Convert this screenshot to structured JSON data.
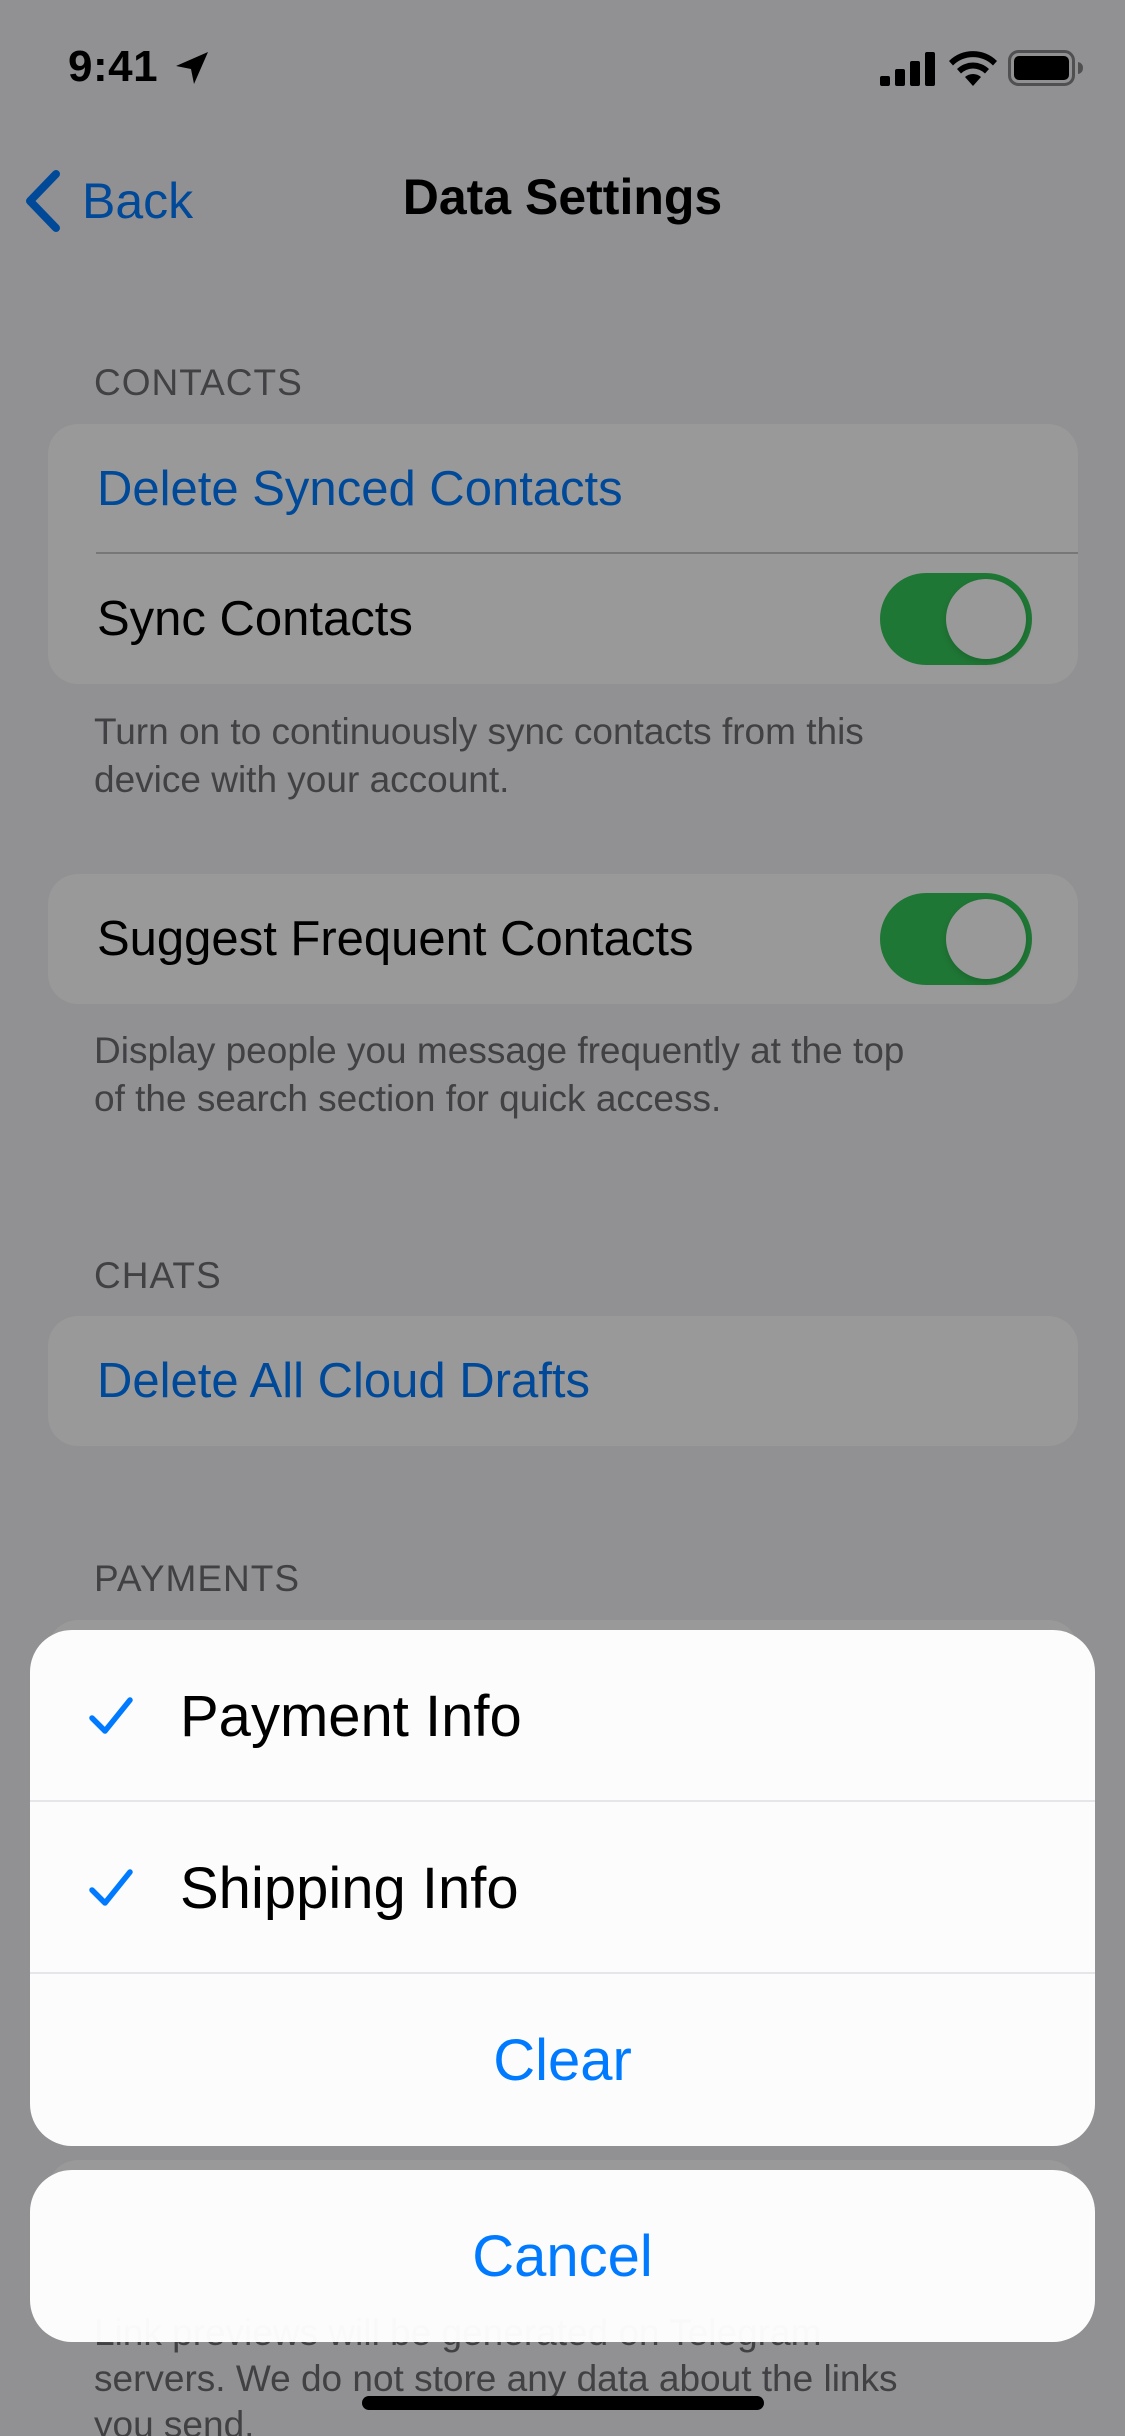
{
  "status_bar": {
    "time": "9:41"
  },
  "nav": {
    "back_label": "Back",
    "title": "Data Settings"
  },
  "contacts": {
    "header": "CONTACTS",
    "delete_synced": "Delete Synced Contacts",
    "sync_contacts": "Sync Contacts",
    "sync_contacts_on": true,
    "sync_footer_line1": "Turn on to continuously sync contacts from this",
    "sync_footer_line2": "device with your account.",
    "suggest_frequent": "Suggest Frequent Contacts",
    "suggest_frequent_on": true,
    "suggest_footer_line1": "Display people you message frequently at the top",
    "suggest_footer_line2": "of the search section for quick access."
  },
  "chats": {
    "header": "CHATS",
    "delete_drafts": "Delete All Cloud Drafts"
  },
  "payments": {
    "header": "PAYMENTS"
  },
  "links_footer": {
    "line1": "Link previews will be generated on Telegram",
    "line2": "servers. We do not store any data about the links",
    "line3": "you send."
  },
  "action_sheet": {
    "options": [
      {
        "label": "Payment Info",
        "checked": true
      },
      {
        "label": "Shipping Info",
        "checked": true
      }
    ],
    "clear_label": "Clear",
    "cancel_label": "Cancel"
  },
  "colors": {
    "accent": "#007aff",
    "toggle_on": "#34c759",
    "background": "#f2f2f7"
  }
}
